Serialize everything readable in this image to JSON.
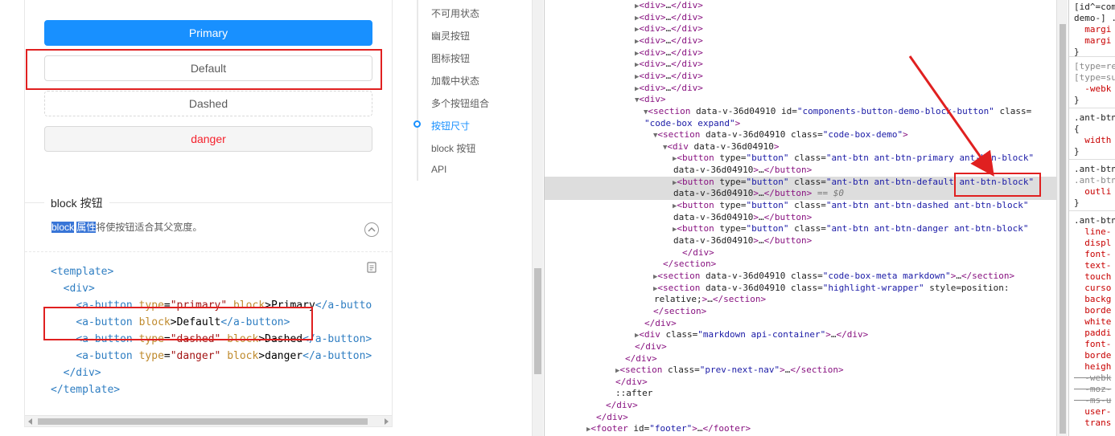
{
  "demo": {
    "buttons": {
      "primary": "Primary",
      "default": "Default",
      "dashed": "Dashed",
      "danger": "danger"
    },
    "meta_title": "block 按钮",
    "desc_sel_1": "block",
    "desc_sel_2": "属性",
    "desc_rest": "将使按钮适合其父宽度。",
    "code": {
      "l1_tag": "<template>",
      "l2_tag": "<div>",
      "l3_open": "<a-button",
      "l3_attr": "type",
      "l3_val": "\"primary\"",
      "l3_attr2": "block",
      "l3_text": "Primary",
      "l3_close": "</a-butto",
      "l4_open": "<a-button",
      "l4_attr": "block",
      "l4_text": "Default",
      "l4_close": "</a-button>",
      "l5_open": "<a-button",
      "l5_attr": "type",
      "l5_val": "\"dashed\"",
      "l5_attr2": "block",
      "l5_text": "Dashed",
      "l5_close": "</a-button>",
      "l6_open": "<a-button",
      "l6_attr": "type",
      "l6_val": "\"danger\"",
      "l6_attr2": "block",
      "l6_text": "danger",
      "l6_close": "</a-button>",
      "l7_tag": "</div>",
      "l8_tag": "</template>"
    }
  },
  "anchor_nav": {
    "items": [
      "不可用状态",
      "幽灵按钮",
      "图标按钮",
      "加载中状态",
      "多个按钮组合",
      "按钮尺寸",
      "block 按钮",
      "API"
    ],
    "active_index": 5
  },
  "devtools": {
    "lines": [
      {
        "indent": 0,
        "text": "▶<div>…</div>"
      },
      {
        "indent": 0,
        "text": "▶<div>…</div>"
      },
      {
        "indent": 0,
        "text": "▶<div>…</div>"
      },
      {
        "indent": 0,
        "text": "▶<div>…</div>"
      },
      {
        "indent": 0,
        "text": "▶<div>…</div>"
      },
      {
        "indent": 0,
        "text": "▶<div>…</div>"
      },
      {
        "indent": 0,
        "text": "▶<div>…</div>"
      },
      {
        "indent": 0,
        "text": "▶<div>…</div>"
      },
      {
        "indent": 0,
        "text": "▼<div>"
      }
    ],
    "section_open": "▼<section data-v-36d04910 id=\"components-button-demo-block-button\" class=",
    "section_open_cont": "\"code-box expand\">",
    "demo_open": "▼<section data-v-36d04910 class=\"code-box-demo\">",
    "div_open": "▼<div data-v-36d04910>",
    "btn1_a": "▶<button type=\"button\" class=\"ant-btn ant-btn-primary ant-btn-block\"",
    "btn1_b": "data-v-36d04910>…</button>",
    "btn2_a": "▶<button type=\"button\" class=\"ant-btn ant-btn-default ant-btn-block\"",
    "btn2_b": "data-v-36d04910>…</button>",
    "btn2_eq": "== $0",
    "btn3_a": "▶<button type=\"button\" class=\"ant-btn ant-btn-dashed ant-btn-block\"",
    "btn3_b": "data-v-36d04910>…</button>",
    "btn4_a": "▶<button type=\"button\" class=\"ant-btn ant-btn-danger ant-btn-block\"",
    "btn4_b": "data-v-36d04910>…</button>",
    "div_close": "</div>",
    "section_close": "</section>",
    "meta_section": "▶<section data-v-36d04910 class=\"code-box-meta markdown\">…</section>",
    "hl_section_a": "▶<section data-v-36d04910 class=\"highlight-wrapper\" style=\"position:",
    "hl_section_b": "relative;\">…</section>",
    "section_close2": "</section>",
    "div_close2": "</div>",
    "api_div": "▶<div class=\"markdown api-container\">…</div>",
    "div_close3": "</div>",
    "div_close4": "</div>",
    "prev_next": "▶<section class=\"prev-next-nav\">…</section>",
    "div_close5": "</div>",
    "after": "::after",
    "div_close6": "</div>",
    "div_close7": "</div>",
    "footer": "▶<footer id=\"footer\">…</footer>"
  },
  "styles": {
    "lines": [
      "[id^=comp",
      "demo-] .",
      "  margi",
      "  margi",
      "}",
      "[type=re",
      "[type=su",
      "  -webk",
      "}",
      ".ant-btn",
      "{",
      "  width",
      "}",
      ".ant-btn",
      ".ant-btn",
      "  outli",
      "}",
      ".ant-btn",
      "  line-",
      "  displ",
      "  font-",
      "  text-",
      "  touch",
      "  curso",
      "  backg",
      "  borde",
      "  white",
      "  paddi",
      "  font-",
      "  borde",
      "  heigh",
      "  -webk",
      "  -moz-",
      "  -ms-u",
      "  user-",
      "  trans"
    ]
  }
}
